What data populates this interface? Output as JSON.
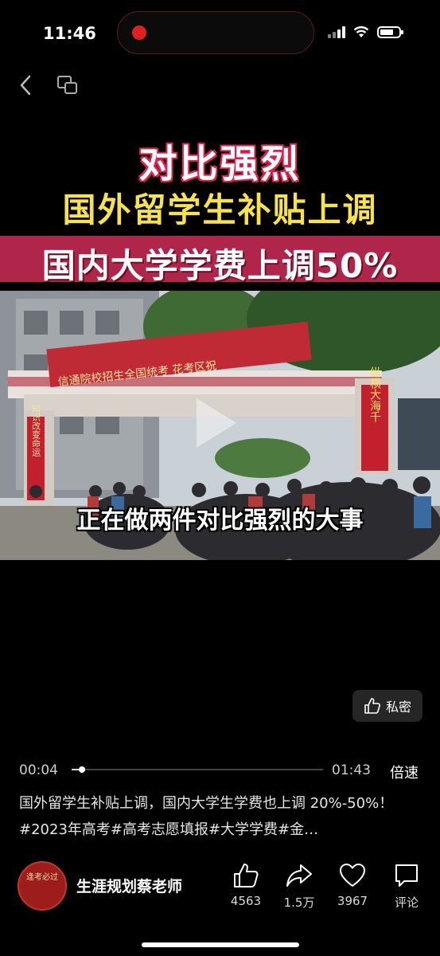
{
  "status_bar": {
    "time": "11:46"
  },
  "video": {
    "title_line1": "对比强烈",
    "title_line2": "国外留学生补贴上调",
    "title_line3": "国内大学学费上调50%",
    "subtitle": "正在做两件对比强烈的大事",
    "banner_text": "信通院校招生全国统考  花考区祝",
    "left_pillar_text": "知识改变命运",
    "right_pillar_text": "纵横大海千",
    "private_label": "私密"
  },
  "player": {
    "current_time": "00:04",
    "total_time": "01:43",
    "progress": 0.04,
    "speed_label": "倍速"
  },
  "description": "国外留学生补贴上调，国内大学生学费也上调 20%-50%！#2023年高考#高考志愿填报#大学学费#金…",
  "author": {
    "name": "生涯规划蔡老师",
    "avatar_text": "逢考必过"
  },
  "actions": {
    "like_count": "4563",
    "share_count": "1.5万",
    "favorite_count": "3967",
    "comment_label": "评论"
  },
  "colors": {
    "title_red": "#e3214f",
    "title_yellow": "#f6e34a",
    "band": "#b0264a"
  }
}
